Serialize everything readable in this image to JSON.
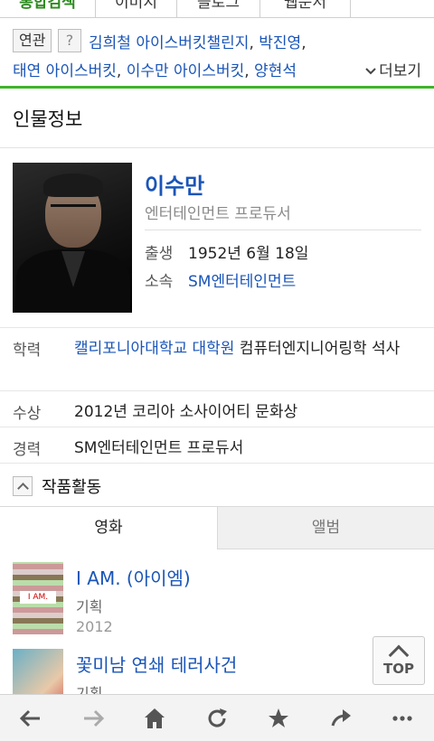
{
  "top_tabs": [
    "통합검색",
    "이미지",
    "블로그",
    "웹문서",
    ""
  ],
  "related": {
    "badge_label": "연관",
    "help_label": "?",
    "line1": [
      {
        "text": "김희철 아이스버킷챌린지",
        "sep": ", "
      },
      {
        "text": "박진영",
        "sep": ","
      }
    ],
    "line2": [
      {
        "text": "태연 아이스버킷",
        "sep": ", "
      },
      {
        "text": "이수만 아이스버킷",
        "sep": ", "
      },
      {
        "text": "양현석",
        "sep": ""
      }
    ],
    "more_label": "더보기"
  },
  "section_title": "인물정보",
  "profile": {
    "name": "이수만",
    "job": "엔터테인먼트 프로듀서",
    "birth_key": "출생",
    "birth_value": "1952년 6월 18일",
    "agency_key": "소속",
    "agency_value": "SM엔터테인먼트"
  },
  "info": {
    "edu_key": "학력",
    "edu_link": "캘리포니아대학교 대학원",
    "edu_rest": " 컴퓨터엔지니어링학 석사",
    "award_key": "수상",
    "award_value": "2012년 코리아 소사이어티 문화상",
    "career_key": "경력",
    "career_value": "SM엔터테인먼트 프로듀서"
  },
  "works": {
    "title": "작품활동",
    "tabs": [
      "영화",
      "앨범"
    ],
    "items": [
      {
        "title": "I AM. (아이엠)",
        "role": "기획",
        "year": "2012",
        "thumb_label": "I AM."
      },
      {
        "title": "꽃미남 연쇄 테러사건",
        "role": "기획",
        "year": ""
      }
    ]
  },
  "top_button_label": "TOP",
  "bottom_bar": [
    "back-icon",
    "forward-icon",
    "home-icon",
    "refresh-icon",
    "star-icon",
    "share-icon",
    "more-icon"
  ],
  "colors": {
    "link": "#1a55b8",
    "accent_green": "#3fb32a"
  }
}
